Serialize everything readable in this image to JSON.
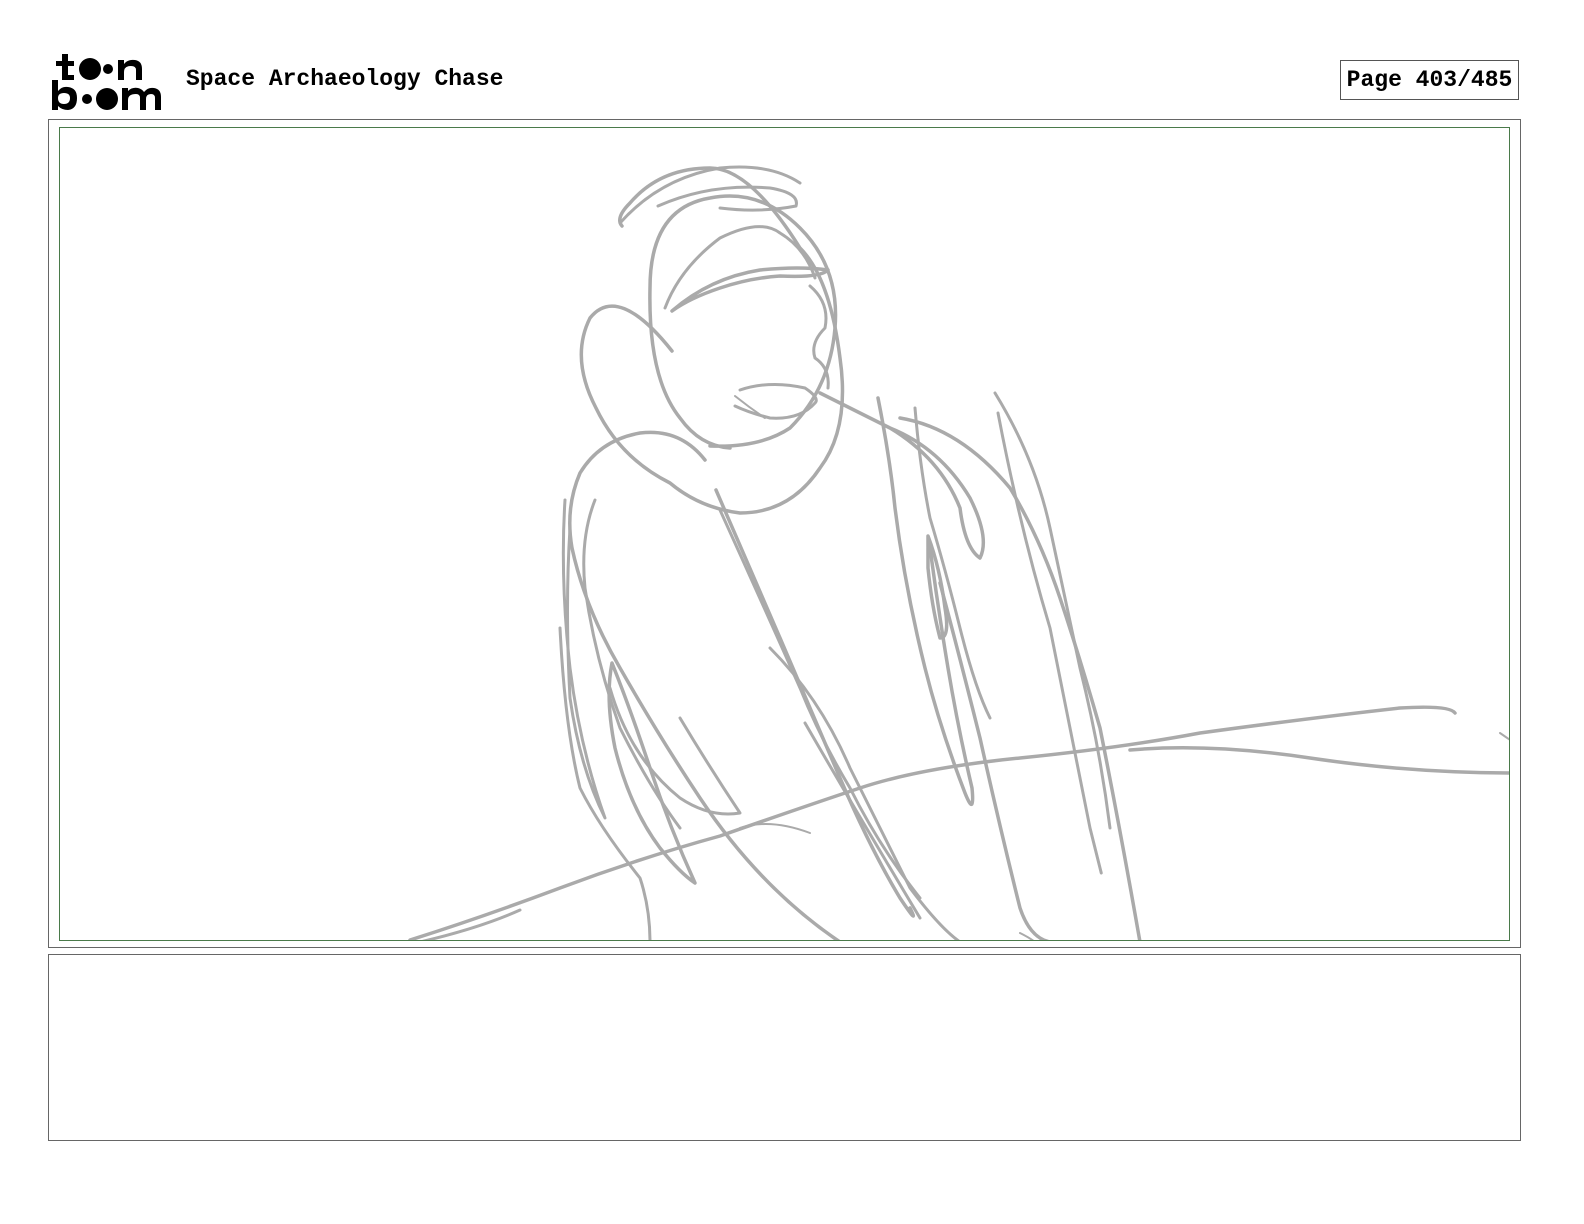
{
  "header": {
    "logo_icon": "toon-boom-logo",
    "project_title": "Space Archaeology Chase",
    "page_indicator": "Page 403/485"
  },
  "panel": {
    "sketch_icon": "rough-pencil-sketch-figure",
    "stroke_color": "#aaaaaa",
    "safe_frame_color": "#4a7a4a"
  },
  "notes": {
    "text": ""
  }
}
